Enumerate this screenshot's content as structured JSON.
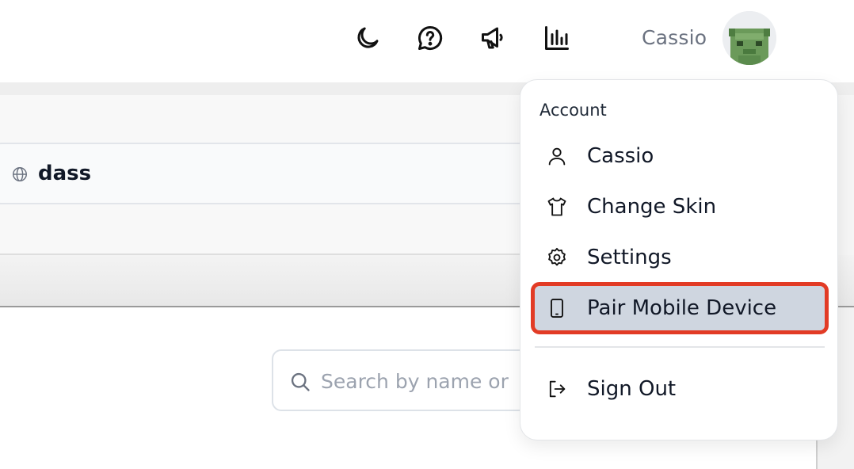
{
  "header": {
    "icons": [
      {
        "name": "moon-icon",
        "label": "theme"
      },
      {
        "name": "help-icon",
        "label": "help"
      },
      {
        "name": "megaphone-icon",
        "label": "announcements"
      },
      {
        "name": "bar-chart-icon",
        "label": "stats"
      }
    ],
    "username": "Cassio"
  },
  "name_card": {
    "name": "dass"
  },
  "search": {
    "placeholder": "Search by name or"
  },
  "account_menu": {
    "header": "Account",
    "items": [
      {
        "label": "Cassio",
        "icon": "user-icon"
      },
      {
        "label": "Change Skin",
        "icon": "shirt-icon"
      },
      {
        "label": "Settings",
        "icon": "gear-icon"
      },
      {
        "label": "Pair Mobile Device",
        "icon": "phone-icon",
        "highlighted": true
      }
    ],
    "sign_out": {
      "label": "Sign Out",
      "icon": "sign-out-icon"
    }
  },
  "colors": {
    "highlight_bg": "#cfd6e0",
    "highlight_border": "#e23b25",
    "avatar_green": "#6b9a5a"
  }
}
